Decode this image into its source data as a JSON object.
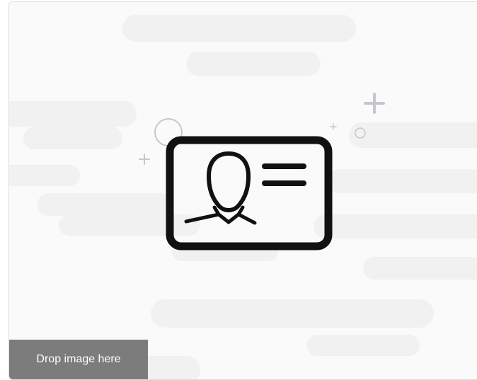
{
  "dropzone": {
    "label": "Drop image here",
    "icon": "id-card-icon",
    "label_bg_color": "#7c7c7c",
    "background_color": "#fafafa"
  }
}
